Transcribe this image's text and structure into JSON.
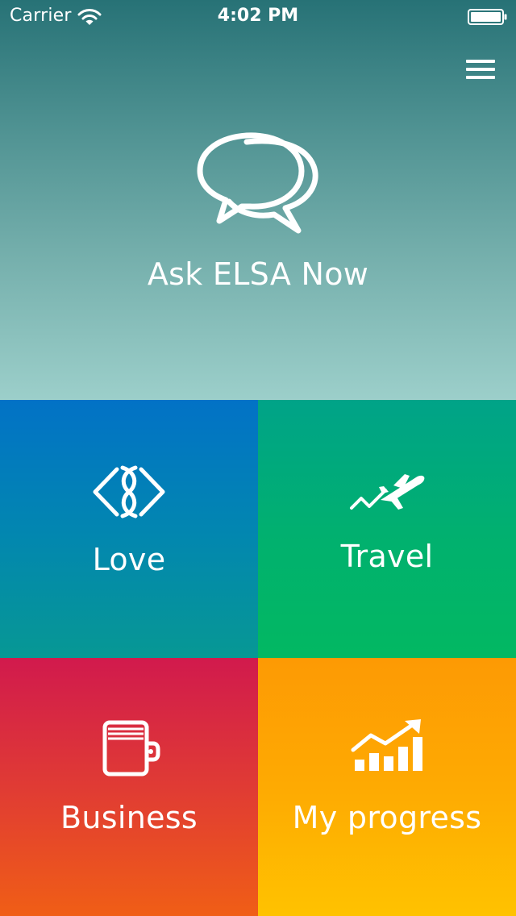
{
  "status_bar": {
    "carrier": "Carrier",
    "time": "4:02 PM",
    "icons": [
      "wifi-icon",
      "battery-icon"
    ]
  },
  "header": {
    "menu_icon": "hamburger-menu-icon"
  },
  "hero": {
    "icon": "chat-bubbles-icon",
    "label": "Ask ELSA Now"
  },
  "tiles": [
    {
      "label": "Love",
      "icon": "infinity-diamond-icon",
      "colors": [
        "#0272c6",
        "#079894"
      ]
    },
    {
      "label": "Travel",
      "icon": "airplane-takeoff-icon",
      "colors": [
        "#00a388",
        "#02b862"
      ]
    },
    {
      "label": "Business",
      "icon": "wallet-icon",
      "colors": [
        "#d11a4d",
        "#f05e16"
      ]
    },
    {
      "label": "My progress",
      "icon": "progress-chart-icon",
      "colors": [
        "#fd9a04",
        "#ffc200"
      ]
    }
  ]
}
